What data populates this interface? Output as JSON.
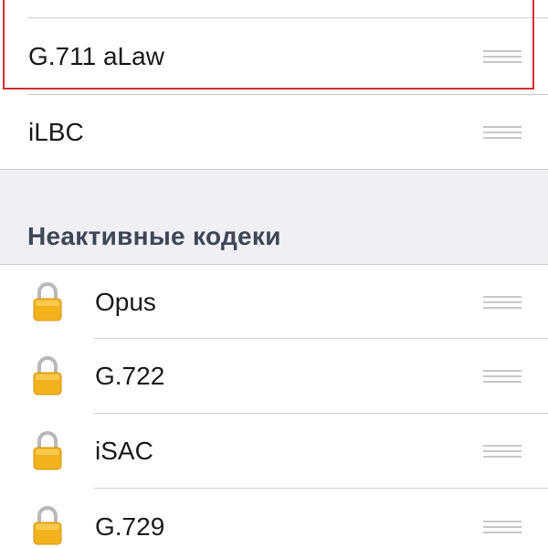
{
  "active_codecs": [
    {
      "label": "G.711 aLaw",
      "highlighted": true
    },
    {
      "label": "iLBC",
      "highlighted": false
    }
  ],
  "inactive_section": {
    "header": "Неактивные кодеки",
    "items": [
      {
        "label": "Opus",
        "icon": "lock-icon"
      },
      {
        "label": "G.722",
        "icon": "lock-icon"
      },
      {
        "label": "iSAC",
        "icon": "lock-icon"
      },
      {
        "label": "G.729",
        "icon": "lock-icon"
      }
    ]
  },
  "colors": {
    "highlight": "#d62b2b",
    "section_background": "#efeff4",
    "separator": "#cfcfd3",
    "grip": "#c7c7cc",
    "lock_body": "#f2b21c"
  }
}
